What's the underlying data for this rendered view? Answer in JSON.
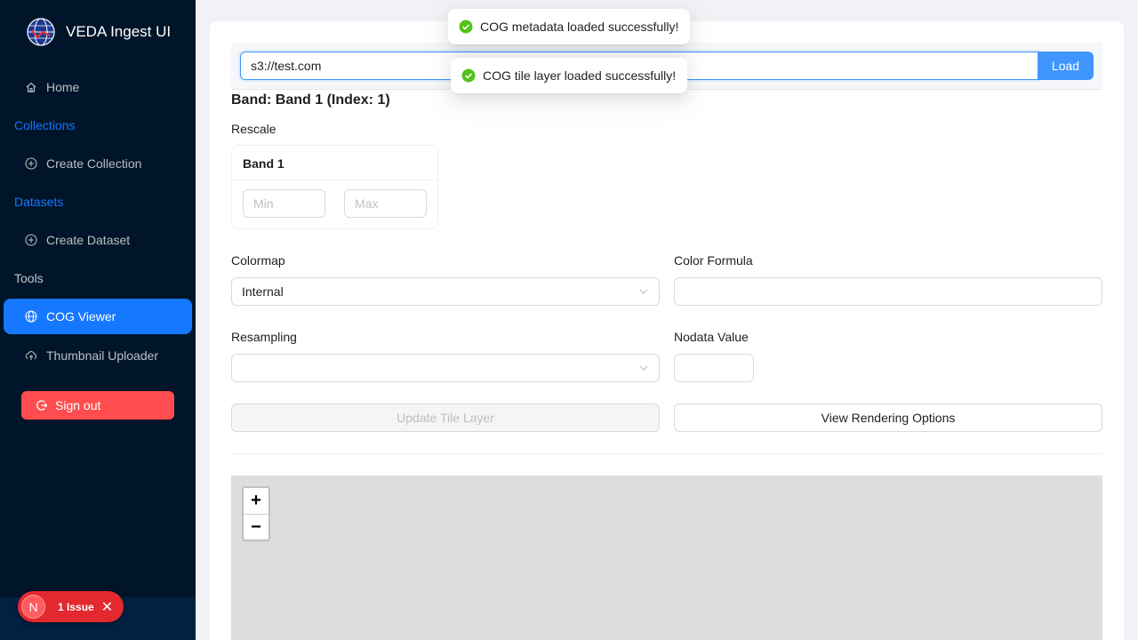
{
  "app": {
    "title": "VEDA Ingest UI"
  },
  "sidebar": {
    "home": "Home",
    "collections_label": "Collections",
    "create_collection": "Create Collection",
    "datasets_label": "Datasets",
    "create_dataset": "Create Dataset",
    "tools_label": "Tools",
    "cog_viewer": "COG Viewer",
    "thumbnail_uploader": "Thumbnail Uploader",
    "sign_out": "Sign out",
    "active_item": "COG Viewer"
  },
  "toasts": [
    {
      "message": "COG metadata loaded successfully!",
      "status": "success"
    },
    {
      "message": "COG tile layer loaded successfully!",
      "status": "success"
    }
  ],
  "url_bar": {
    "value": "s3://test.com",
    "load_label": "Load"
  },
  "band": {
    "title": "Band: Band 1 (Index: 1)",
    "rescale_label": "Rescale",
    "card_title": "Band 1",
    "min_placeholder": "Min",
    "max_placeholder": "Max"
  },
  "form": {
    "colormap_label": "Colormap",
    "colormap_value": "Internal",
    "color_formula_label": "Color Formula",
    "color_formula_value": "",
    "resampling_label": "Resampling",
    "resampling_value": "",
    "nodata_label": "Nodata Value",
    "nodata_value": ""
  },
  "actions": {
    "update_tile_layer": "Update Tile Layer",
    "view_rendering_options": "View Rendering Options"
  },
  "map": {
    "zoom_in": "+",
    "zoom_out": "−"
  },
  "dev_badge": {
    "letter": "N",
    "issues": "1 Issue",
    "close": "✕"
  },
  "colors": {
    "primary": "#1677ff",
    "sidebar_bg": "#001529",
    "danger": "#ff4d4f",
    "success": "#52c41a"
  }
}
